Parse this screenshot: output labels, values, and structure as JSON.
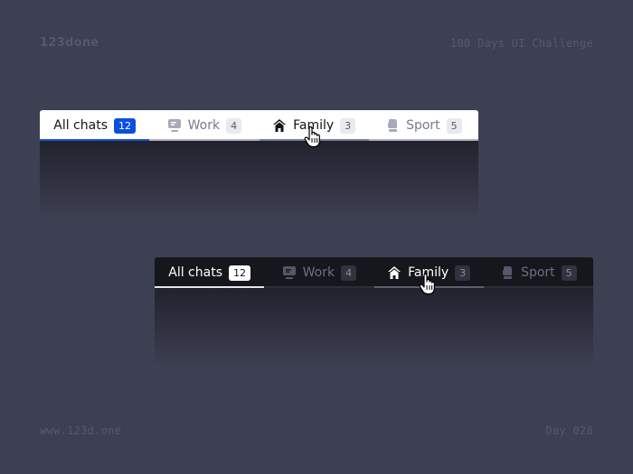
{
  "header": {
    "brand": "123done",
    "challenge": "100 Days UI Challenge"
  },
  "footer": {
    "site": "www.123d.one",
    "day": "Day 028"
  },
  "light_tabs": [
    {
      "label": "All chats",
      "count": "12",
      "icon": "none",
      "state": "active"
    },
    {
      "label": "Work",
      "count": "4",
      "icon": "monitor-icon",
      "state": "default"
    },
    {
      "label": "Family",
      "count": "3",
      "icon": "home-icon",
      "state": "hover"
    },
    {
      "label": "Sport",
      "count": "5",
      "icon": "boxing-glove-icon",
      "state": "default"
    }
  ],
  "dark_tabs": [
    {
      "label": "All chats",
      "count": "12",
      "icon": "none",
      "state": "active"
    },
    {
      "label": "Work",
      "count": "4",
      "icon": "monitor-icon",
      "state": "default"
    },
    {
      "label": "Family",
      "count": "3",
      "icon": "home-icon",
      "state": "hover"
    },
    {
      "label": "Sport",
      "count": "5",
      "icon": "boxing-glove-icon",
      "state": "default"
    }
  ],
  "colors": {
    "background": "#3d3f52",
    "light_active_badge": "#0c4fdf",
    "light_active_underline": "#1a56e2",
    "dark_tabbar": "#16171d"
  }
}
